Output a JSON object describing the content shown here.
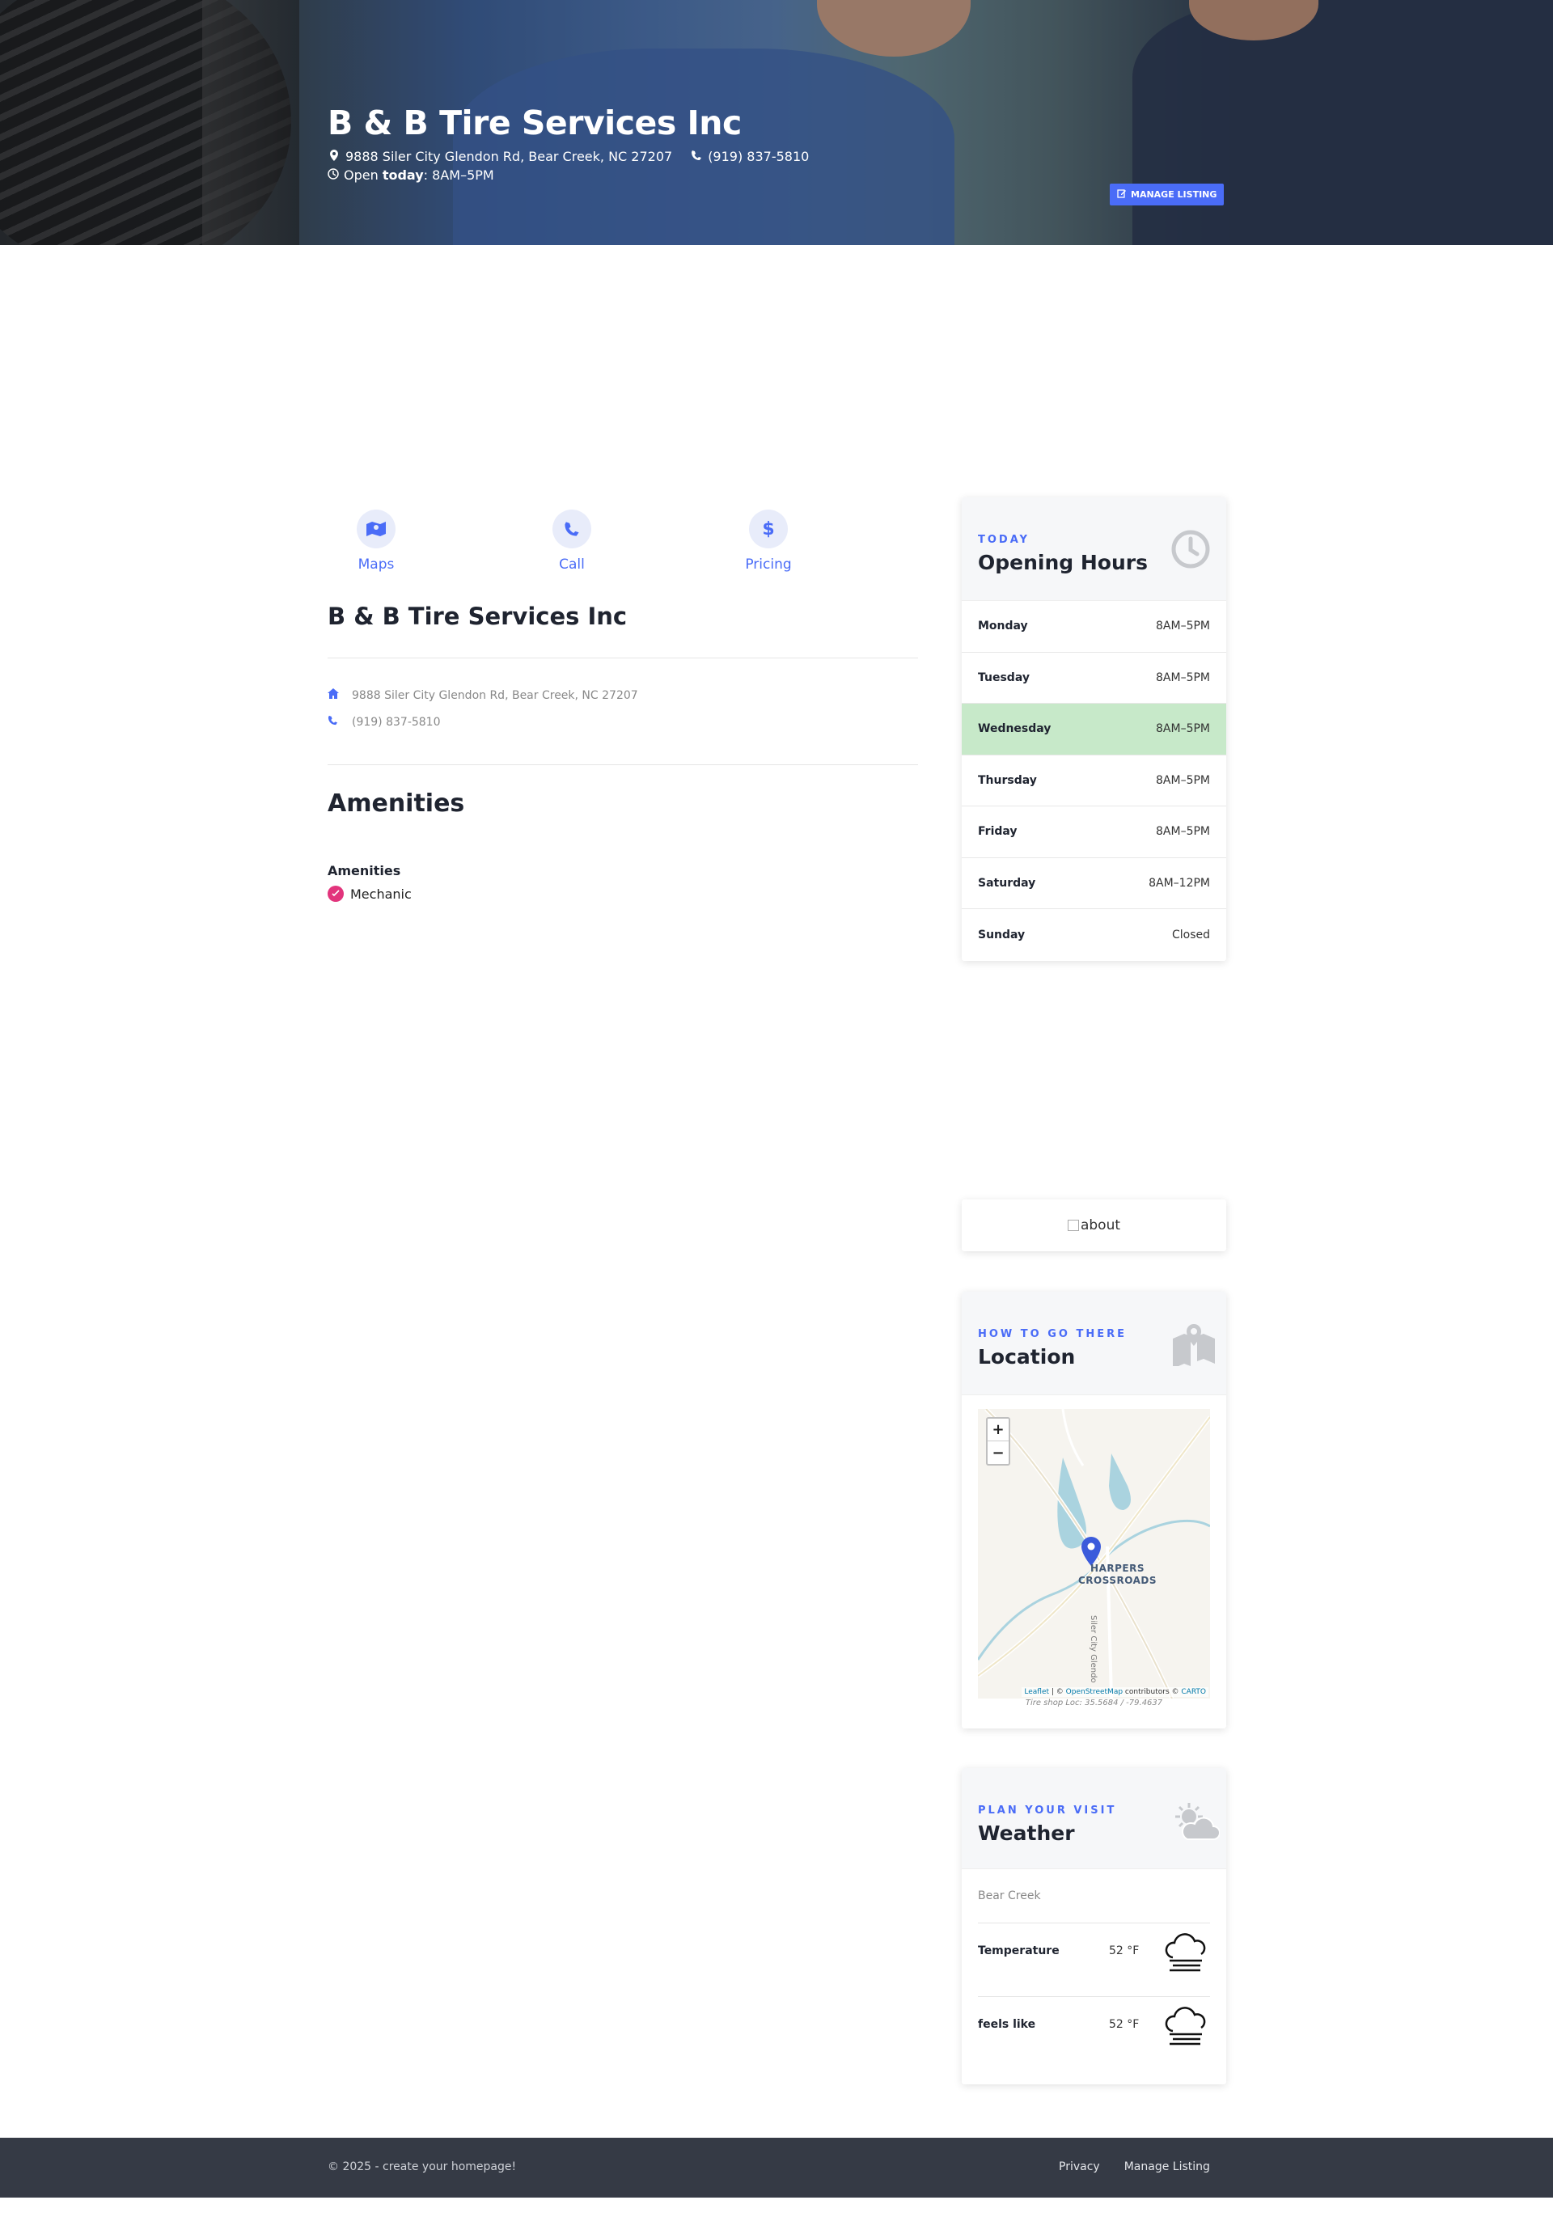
{
  "hero": {
    "title": "B & B Tire Services Inc",
    "address": "9888 Siler City Glendon Rd, Bear Creek, NC 27207",
    "phone": "(919) 837-5810",
    "open_prefix": "Open",
    "open_today": "today",
    "open_hours": ": 8AM–5PM",
    "manage_label": "MANAGE LISTING"
  },
  "actions": [
    {
      "label": "Maps",
      "icon": "map-icon"
    },
    {
      "label": "Call",
      "icon": "phone-icon"
    },
    {
      "label": "Pricing",
      "icon": "dollar-icon"
    }
  ],
  "business": {
    "title": "B & B Tire Services Inc",
    "address": "9888 Siler City Glendon Rd, Bear Creek, NC 27207",
    "phone": "(919) 837-5810"
  },
  "amenities": {
    "heading": "Amenities",
    "subheading": "Amenities",
    "items": [
      "Mechanic"
    ]
  },
  "hours_card": {
    "kicker": "TODAY",
    "title": "Opening Hours",
    "rows": [
      {
        "day": "Monday",
        "time": "8AM–5PM"
      },
      {
        "day": "Tuesday",
        "time": "8AM–5PM"
      },
      {
        "day": "Wednesday",
        "time": "8AM–5PM",
        "today": true
      },
      {
        "day": "Thursday",
        "time": "8AM–5PM"
      },
      {
        "day": "Friday",
        "time": "8AM–5PM"
      },
      {
        "day": "Saturday",
        "time": "8AM–12PM"
      },
      {
        "day": "Sunday",
        "time": "Closed"
      }
    ]
  },
  "about_card": {
    "alt": "about"
  },
  "location_card": {
    "kicker": "HOW TO GO THERE",
    "title": "Location",
    "zoom_in": "+",
    "zoom_out": "−",
    "place_line1": "HARPERS",
    "place_line2": "CROSSROADS",
    "road_label": "Siler City Glendo",
    "attrib_leaflet": "Leaflet",
    "attrib_mid": " | © ",
    "attrib_osm": "OpenStreetMap",
    "attrib_contrib": " contributors © ",
    "attrib_carto": "CARTO",
    "caption": "Tire shop Loc: 35.5684 / -79.4637"
  },
  "weather_card": {
    "kicker": "PLAN YOUR VISIT",
    "title": "Weather",
    "location": "Bear Creek",
    "rows": [
      {
        "label": "Temperature",
        "value": "52 °F",
        "icon": "fog-cloud-icon"
      },
      {
        "label": "feels like",
        "value": "52 °F",
        "icon": "fog-cloud-icon"
      }
    ]
  },
  "footer": {
    "copyright": "© 2025 - create your homepage!",
    "links": [
      "Privacy",
      "Manage Listing"
    ]
  },
  "colors": {
    "accent": "#4a6cf7",
    "today_row": "#c7e9c9",
    "footer_bg": "#353a45",
    "amenity_badge": "#e2347c"
  }
}
